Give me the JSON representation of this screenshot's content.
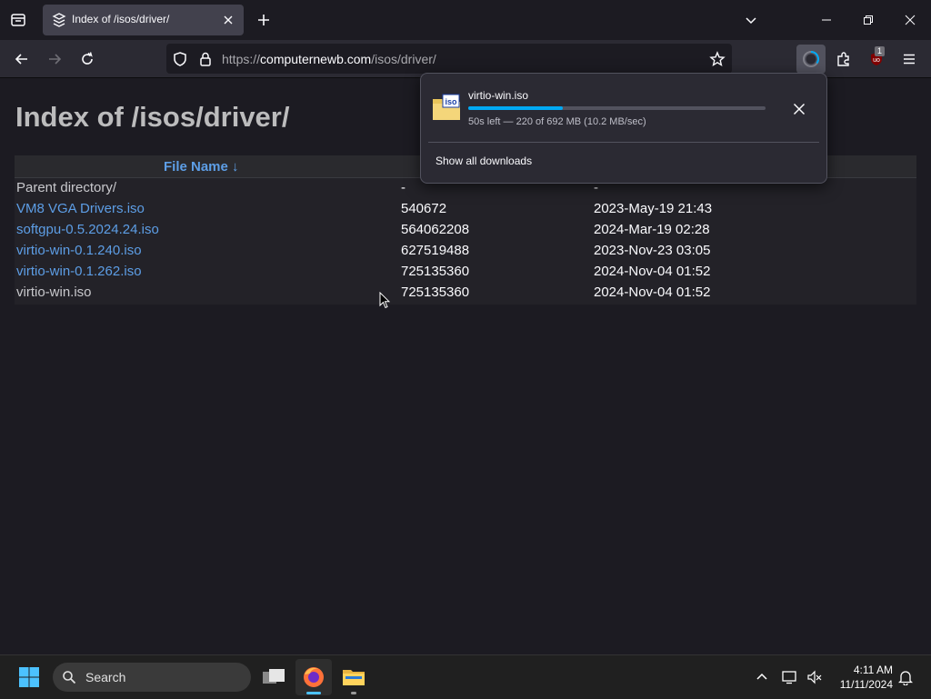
{
  "browser": {
    "tab_title": "Index of /isos/driver/",
    "url_scheme": "https://",
    "url_host": "computernewb.com",
    "url_path": "/isos/driver/",
    "extension_badge": "1"
  },
  "page": {
    "heading": "Index of /isos/driver/",
    "columns": {
      "name": "File Name  ↓"
    },
    "rows": [
      {
        "name": "Parent directory/",
        "size": "-",
        "date": "-",
        "link": false
      },
      {
        "name": "VM8 VGA Drivers.iso",
        "size": "540672",
        "date": "2023-May-19 21:43",
        "link": true
      },
      {
        "name": "softgpu-0.5.2024.24.iso",
        "size": "564062208",
        "date": "2024-Mar-19 02:28",
        "link": true
      },
      {
        "name": "virtio-win-0.1.240.iso",
        "size": "627519488",
        "date": "2023-Nov-23 03:05",
        "link": true
      },
      {
        "name": "virtio-win-0.1.262.iso",
        "size": "725135360",
        "date": "2024-Nov-04 01:52",
        "link": true
      },
      {
        "name": "virtio-win.iso",
        "size": "725135360",
        "date": "2024-Nov-04 01:52",
        "link": false
      }
    ]
  },
  "downloads": {
    "filename": "virtio-win.iso",
    "status": "50s left — 220 of 692 MB (10.2 MB/sec)",
    "progress_fraction": 0.318,
    "show_all": "Show all downloads"
  },
  "taskbar": {
    "search_placeholder": "Search",
    "time": "4:11 AM",
    "date": "11/11/2024"
  },
  "colors": {
    "accent": "#00a9f4",
    "link": "#5d9ee6"
  }
}
